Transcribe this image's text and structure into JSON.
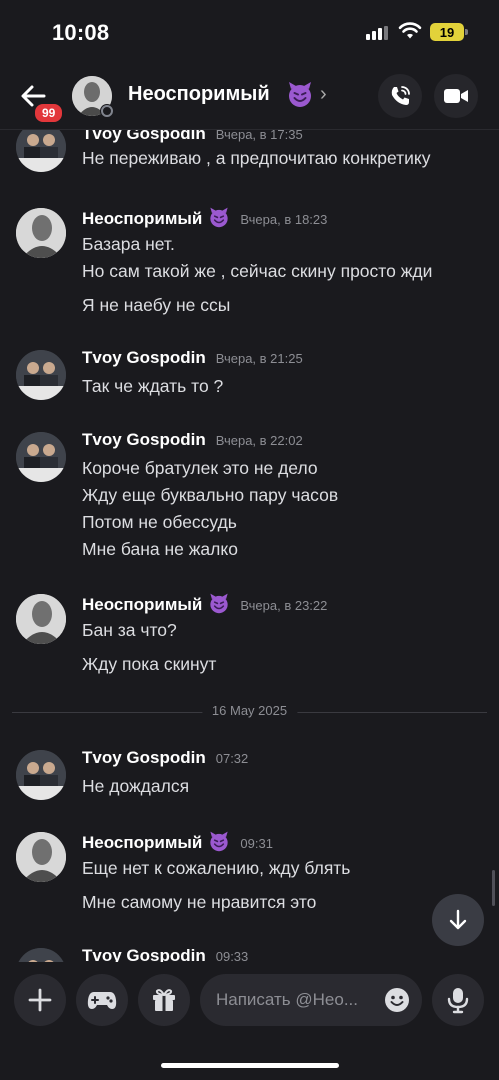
{
  "status_bar": {
    "time": "10:08",
    "battery": "19"
  },
  "header": {
    "back_badge": "99",
    "contact_name": "Неоспоримый",
    "chevron": "›"
  },
  "messages": [
    {
      "author": "Tvoy Gospodin",
      "time": "Вчера, в 17:35",
      "lines": [
        "Не переживаю , а предпочитаю конкретику"
      ]
    },
    {
      "author": "Неоспоримый",
      "time": "Вчера, в 18:23",
      "lines": [
        "Базара нет.",
        "Но сам такой же , сейчас скину просто жди",
        "Я не наебу не ссы"
      ]
    },
    {
      "author": "Tvoy Gospodin",
      "time": "Вчера, в 21:25",
      "lines": [
        "Так че ждать то ?"
      ]
    },
    {
      "author": "Tvoy Gospodin",
      "time": "Вчера, в 22:02",
      "lines": [
        "Короче братулек это не дело",
        "Жду еще буквально пару часов",
        "Потом не обессудь",
        "Мне бана не жалко"
      ]
    },
    {
      "author": "Неоспоримый",
      "time": "Вчера, в 23:22",
      "lines": [
        "Бан за что?",
        "Жду пока скинут"
      ]
    },
    {
      "author": "Tvoy Gospodin",
      "time": "07:32",
      "lines": [
        "Не дождался"
      ]
    },
    {
      "author": "Неоспоримый",
      "time": "09:31",
      "lines": [
        "Еще нет к сожалению, жду блять",
        "Мне самому не нравится это"
      ]
    },
    {
      "author": "Tvoy Gospodin",
      "time": "09:33",
      "lines": []
    }
  ],
  "date_divider": "16 May 2025",
  "composer": {
    "placeholder": "Написать @Нео..."
  },
  "icons": {
    "back": "arrow-left-icon",
    "call": "phone-call-icon",
    "video": "video-camera-icon",
    "plus": "plus-icon",
    "game": "gamepad-icon",
    "gift": "gift-icon",
    "emoji": "emoji-icon",
    "mic": "microphone-icon",
    "scroll": "arrow-down-icon",
    "emoji_badge": "smiling-devil-emoji"
  },
  "colors": {
    "background": "#1a1a1e",
    "badge": "#e2373b",
    "devil": "#9b59d0",
    "battery": "#e2d23a"
  }
}
